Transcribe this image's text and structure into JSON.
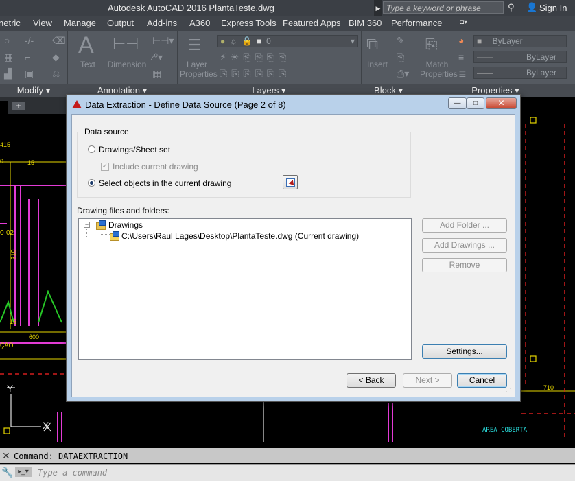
{
  "app": {
    "title": "Autodesk AutoCAD 2016    PlantaTeste.dwg",
    "search_placeholder": "Type a keyword or phrase",
    "sign_in": "Sign In"
  },
  "ribbon_tabs": [
    "netric",
    "View",
    "Manage",
    "Output",
    "Add-ins",
    "A360",
    "Express Tools",
    "Featured Apps",
    "BIM 360",
    "Performance"
  ],
  "ribbon": {
    "panels": {
      "modify": "Modify",
      "annotation": "Annotation",
      "layers": "Layers",
      "block": "Block",
      "properties": "Properties"
    },
    "text_label": "Text",
    "dimension_label": "Dimension",
    "layer_properties_label": "Layer Properties",
    "insert_label": "Insert",
    "match_properties_label": "Match Properties",
    "layer_value": "0",
    "bylayer_color": "ByLayer",
    "bylayer_linetype": "ByLayer",
    "bylayer_lineweight": "ByLayer"
  },
  "drawing": {
    "labels": {
      "l1": "415",
      "l2": "0",
      "l3": "15",
      "l4": "0",
      "l5": "02",
      "l6": "310",
      "l7": "15",
      "l8": "600",
      "l9": "ÇÃO",
      "l10": "710",
      "l11": "AREA COBERTA",
      "l12": "Y",
      "l13": "X"
    }
  },
  "command": {
    "history": "Command: DATAEXTRACTION",
    "placeholder": "Type a command"
  },
  "dialog": {
    "title": "Data Extraction - Define Data Source (Page 2 of 8)",
    "group_label": "Data source",
    "option_drawings": "Drawings/Sheet set",
    "option_include": "Include current drawing",
    "option_select": "Select objects in the current drawing",
    "files_label": "Drawing files and folders:",
    "tree_root": "Drawings",
    "tree_file": "C:\\Users\\Raul Lages\\Desktop\\PlantaTeste.dwg (Current drawing)",
    "buttons": {
      "add_folder": "Add Folder ...",
      "add_drawings": "Add Drawings ...",
      "remove": "Remove",
      "settings": "Settings...",
      "back": "< Back",
      "next": "Next >",
      "cancel": "Cancel"
    }
  }
}
